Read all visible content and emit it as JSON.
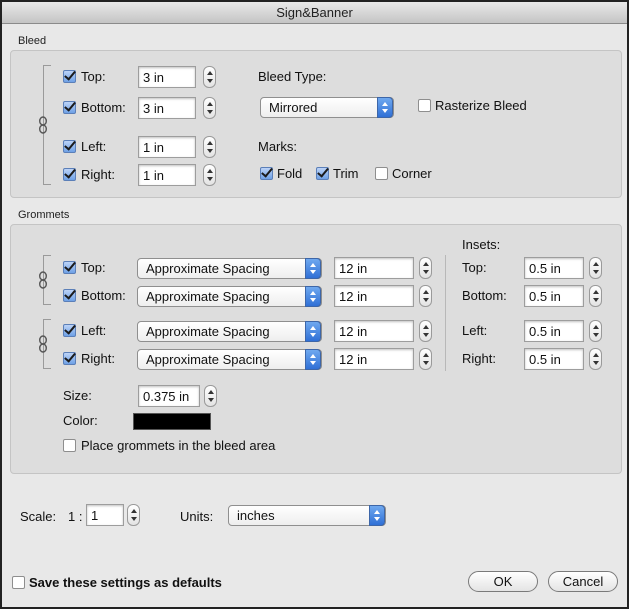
{
  "window": {
    "title": "Sign&Banner"
  },
  "bleed": {
    "section_label": "Bleed",
    "top": {
      "label": "Top:",
      "checked": true,
      "value": "3 in"
    },
    "bottom": {
      "label": "Bottom:",
      "checked": true,
      "value": "3 in"
    },
    "left": {
      "label": "Left:",
      "checked": true,
      "value": "1 in"
    },
    "right": {
      "label": "Right:",
      "checked": true,
      "value": "1 in"
    },
    "bleed_type_label": "Bleed Type:",
    "bleed_type_value": "Mirrored",
    "rasterize": {
      "label": "Rasterize Bleed",
      "checked": false
    },
    "marks_label": "Marks:",
    "marks": [
      {
        "label": "Fold",
        "checked": true
      },
      {
        "label": "Trim",
        "checked": true
      },
      {
        "label": "Corner",
        "checked": false
      }
    ]
  },
  "grommets": {
    "section_label": "Grommets",
    "insets_label": "Insets:",
    "rows": [
      {
        "label": "Top:",
        "checked": true,
        "mode": "Approximate Spacing",
        "value": "12 in",
        "inset_label": "Top:",
        "inset": "0.5 in"
      },
      {
        "label": "Bottom:",
        "checked": true,
        "mode": "Approximate Spacing",
        "value": "12 in",
        "inset_label": "Bottom:",
        "inset": "0.5 in"
      },
      {
        "label": "Left:",
        "checked": true,
        "mode": "Approximate Spacing",
        "value": "12 in",
        "inset_label": "Left:",
        "inset": "0.5 in"
      },
      {
        "label": "Right:",
        "checked": true,
        "mode": "Approximate Spacing",
        "value": "12 in",
        "inset_label": "Right:",
        "inset": "0.5 in"
      }
    ],
    "size_label": "Size:",
    "size_value": "0.375 in",
    "color_label": "Color:",
    "color_value": "#000000",
    "place_in_bleed": {
      "label": "Place grommets in the bleed area",
      "checked": false
    }
  },
  "scale": {
    "label": "Scale:",
    "prefix": "1 :",
    "value": "1"
  },
  "units": {
    "label": "Units:",
    "value": "inches"
  },
  "footer": {
    "save_defaults": {
      "label": "Save these settings as defaults",
      "checked": false
    },
    "ok_label": "OK",
    "cancel_label": "Cancel"
  }
}
